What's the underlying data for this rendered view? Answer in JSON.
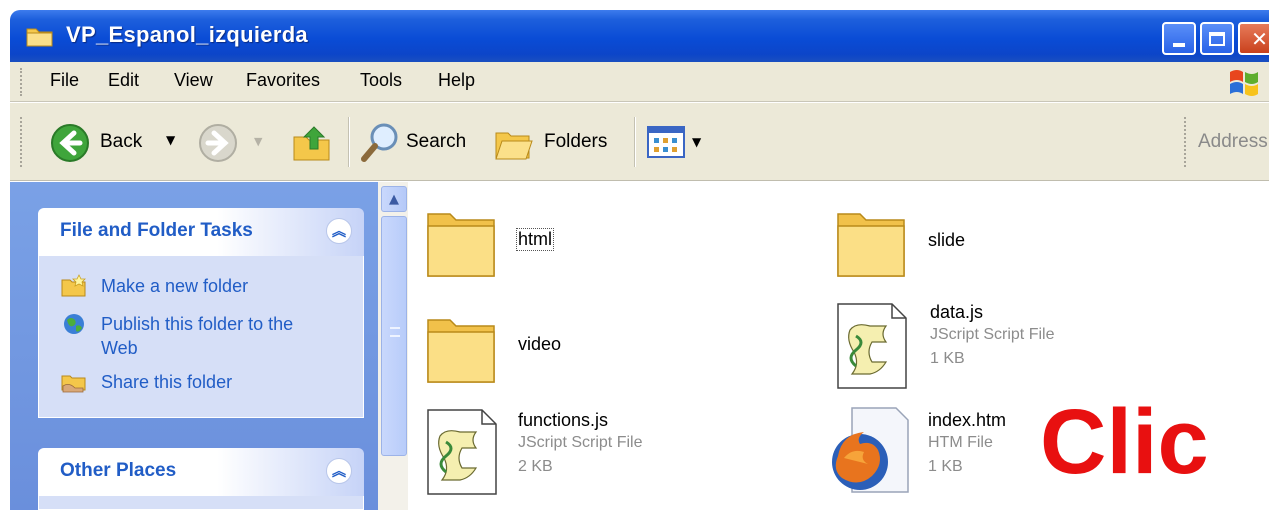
{
  "window": {
    "title": "VP_Espanol_izquierda"
  },
  "menu": [
    "File",
    "Edit",
    "View",
    "Favorites",
    "Tools",
    "Help"
  ],
  "toolbar": {
    "back": "Back",
    "search": "Search",
    "folders": "Folders",
    "address": "Address"
  },
  "tasks_panel": {
    "title": "File and Folder Tasks",
    "items": [
      {
        "label": "Make a new folder"
      },
      {
        "label": "Publish this folder to the Web"
      },
      {
        "label": "Share this folder"
      }
    ]
  },
  "other_places": {
    "title": "Other Places"
  },
  "files": [
    {
      "name": "html",
      "type": "",
      "size": "",
      "icon": "folder-icon"
    },
    {
      "name": "slide",
      "type": "",
      "size": "",
      "icon": "folder-icon"
    },
    {
      "name": "video",
      "type": "",
      "size": "",
      "icon": "folder-icon"
    },
    {
      "name": "data.js",
      "type": "JScript Script File",
      "size": "1 KB",
      "icon": "script-file-icon"
    },
    {
      "name": "functions.js",
      "type": "JScript Script File",
      "size": "2 KB",
      "icon": "script-file-icon"
    },
    {
      "name": "index.htm",
      "type": "HTM File",
      "size": "1 KB",
      "icon": "firefox-icon"
    }
  ],
  "overlay": {
    "text": "Clic",
    "color": "#e81010"
  },
  "colors": {
    "titlebar": "#0a4cd6",
    "task_link": "#215dc6",
    "task_pane": "#7aa1e6"
  }
}
